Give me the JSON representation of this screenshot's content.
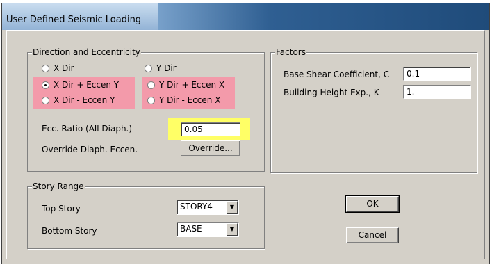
{
  "window": {
    "title": "User Defined Seismic Loading"
  },
  "direction": {
    "legend": "Direction and Eccentricity",
    "options": [
      {
        "label": "X Dir",
        "checked": false
      },
      {
        "label": "Y Dir",
        "checked": false
      },
      {
        "label": "X Dir + Eccen Y",
        "checked": true
      },
      {
        "label": "Y Dir + Eccen X",
        "checked": false
      },
      {
        "label": "X Dir - Eccen Y",
        "checked": false
      },
      {
        "label": "Y Dir - Eccen X",
        "checked": false
      }
    ],
    "ecc_ratio_label": "Ecc. Ratio (All Diaph.)",
    "ecc_ratio_value": "0.05",
    "override_label": "Override Diaph. Eccen.",
    "override_button": "Override..."
  },
  "factors": {
    "legend": "Factors",
    "base_shear_label": "Base Shear Coefficient, C",
    "base_shear_value": "0.1",
    "height_exp_label": "Building Height Exp., K",
    "height_exp_value": "1."
  },
  "story_range": {
    "legend": "Story Range",
    "top_label": "Top Story",
    "top_value": "STORY4",
    "bottom_label": "Bottom Story",
    "bottom_value": "BASE"
  },
  "buttons": {
    "ok": "OK",
    "cancel": "Cancel"
  },
  "colors": {
    "highlight_pink": "#f39aaa",
    "highlight_yellow": "#ffff66"
  }
}
